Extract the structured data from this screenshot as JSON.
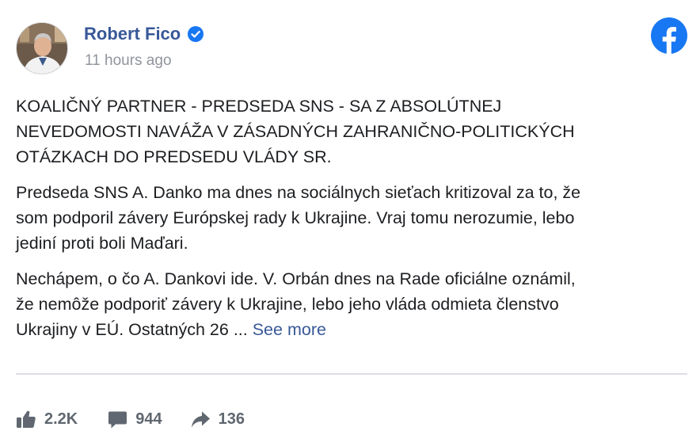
{
  "post": {
    "author_name": "Robert Fico",
    "timestamp": "11 hours ago",
    "paragraphs": [
      "KOALIČNÝ PARTNER - PREDSEDA SNS - SA Z ABSOLÚTNEJ\nNEVEDOMOSTI NAVÁŽA V ZÁSADNÝCH ZAHRANIČNO-POLITICKÝCH\nOTÁZKACH DO PREDSEDU VLÁDY SR.",
      "Predseda SNS A. Danko ma dnes na sociálnych sieťach kritizoval za to, že\nsom podporil závery Európskej rady k Ukrajine. Vraj tomu nerozumie, lebo\njediní proti boli Maďari.",
      "Nechápem, o čo A. Dankovi ide. V. Orbán dnes na Rade oficiálne oznámil,\nže nemôže podporiť závery k Ukrajine, lebo jeho vláda odmieta členstvo\nUkrajiny v EÚ. Ostatných 26 ... "
    ],
    "see_more_label": "See more"
  },
  "reactions": {
    "likes": "2.2K",
    "comments": "944",
    "shares": "136"
  },
  "icons": {
    "avatar": "profile-photo",
    "verified": "verified-badge-icon",
    "brand": "facebook-logo-icon",
    "like": "thumbs-up-icon",
    "comment": "comment-bubble-icon",
    "share": "share-arrow-icon"
  },
  "colors": {
    "link_blue": "#385898",
    "facebook_blue": "#1877f2",
    "muted_text": "#90949c",
    "action_gray": "#606770"
  }
}
